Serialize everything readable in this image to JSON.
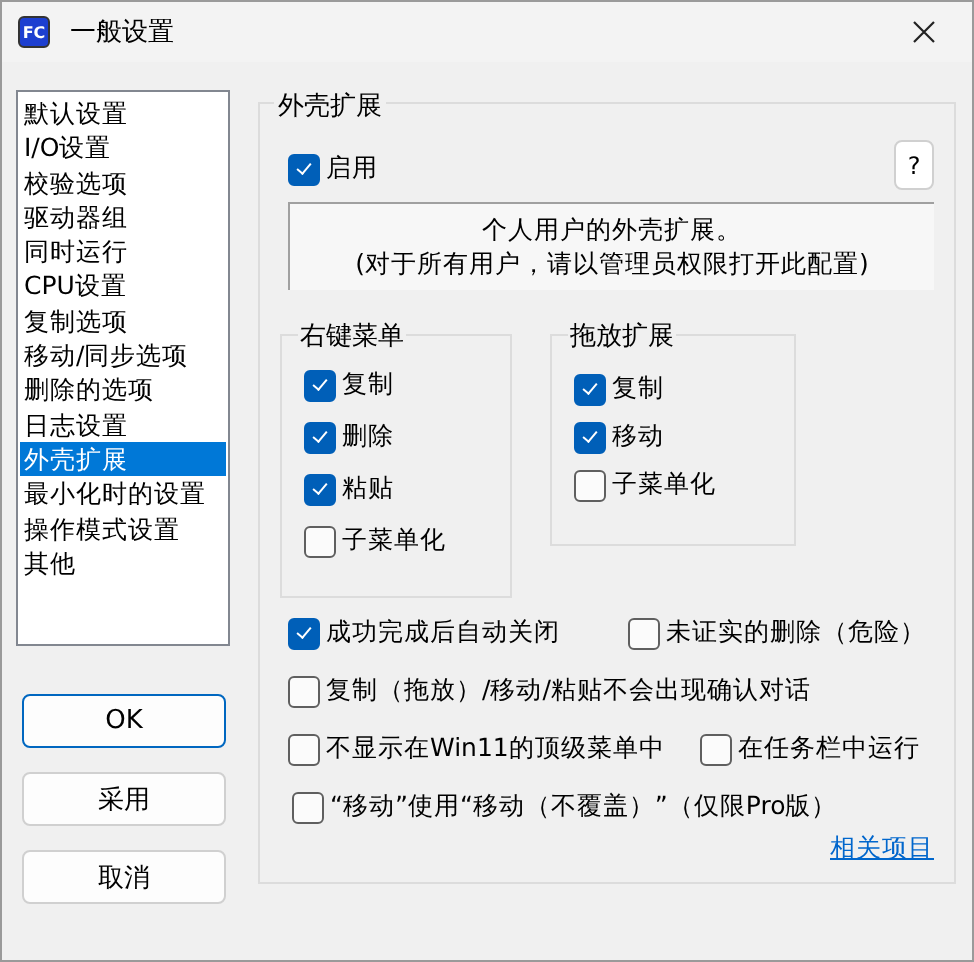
{
  "window": {
    "icon_text": "FC",
    "title": "一般设置"
  },
  "sidebar": {
    "items": [
      {
        "label": "默认设置",
        "selected": false
      },
      {
        "label": "I/O设置",
        "selected": false
      },
      {
        "label": "校验选项",
        "selected": false
      },
      {
        "label": "驱动器组",
        "selected": false
      },
      {
        "label": "同时运行",
        "selected": false
      },
      {
        "label": "CPU设置",
        "selected": false
      },
      {
        "label": "复制选项",
        "selected": false
      },
      {
        "label": "移动/同步选项",
        "selected": false
      },
      {
        "label": "删除的选项",
        "selected": false
      },
      {
        "label": "日志设置",
        "selected": false
      },
      {
        "label": "外壳扩展",
        "selected": true
      },
      {
        "label": "最小化时的设置",
        "selected": false
      },
      {
        "label": "操作模式设置",
        "selected": false
      },
      {
        "label": "其他",
        "selected": false
      }
    ]
  },
  "buttons": [
    {
      "label": "OK",
      "default": true
    },
    {
      "label": "采用",
      "default": false
    },
    {
      "label": "取消",
      "default": false
    }
  ],
  "panel": {
    "title": "外壳扩展",
    "help_button": "?",
    "enable": {
      "label": "启用",
      "checked": true
    },
    "info_lines": [
      "个人用户的外壳扩展。",
      "(对于所有用户，请以管理员权限打开此配置)"
    ],
    "context_menu": {
      "title": "右键菜单",
      "items": [
        {
          "label": "复制",
          "checked": true
        },
        {
          "label": "删除",
          "checked": true
        },
        {
          "label": "粘贴",
          "checked": true
        },
        {
          "label": "子菜单化",
          "checked": false
        }
      ]
    },
    "drag_drop": {
      "title": "拖放扩展",
      "items": [
        {
          "label": "复制",
          "checked": true
        },
        {
          "label": "移动",
          "checked": true
        },
        {
          "label": "子菜单化",
          "checked": false
        }
      ]
    },
    "options": [
      [
        {
          "label": "成功完成后自动关闭",
          "checked": true
        },
        {
          "label": "未证实的删除（危险）",
          "checked": false
        }
      ],
      [
        {
          "label": "复制（拖放）/移动/粘贴不会出现确认对话",
          "checked": false
        }
      ],
      [
        {
          "label": "不显示在Win11的顶级菜单中",
          "checked": false
        },
        {
          "label": "在任务栏中运行",
          "checked": false
        }
      ],
      [
        {
          "label": "“移动”使用“移动（不覆盖）”（仅限Pro版）",
          "checked": false
        }
      ]
    ],
    "link": "相关项目"
  }
}
